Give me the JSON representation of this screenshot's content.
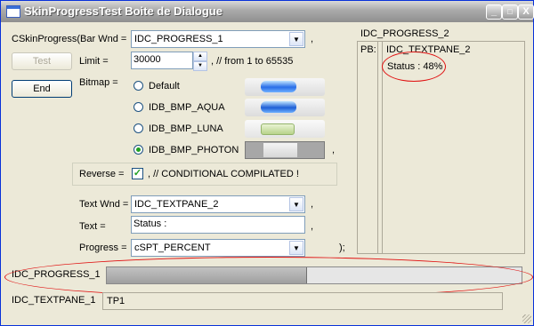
{
  "window": {
    "title": "SkinProgressTest Boite de Dialogue"
  },
  "titlebar_buttons": [
    "_",
    "□",
    "X"
  ],
  "left": {
    "bar_wnd_label": "CSkinProgress(Bar Wnd =",
    "bar_wnd_value": "IDC_PROGRESS_1",
    "bar_wnd_suffix": ",",
    "test_button": "Test",
    "end_button": "End",
    "limit_label": "Limit =",
    "limit_value": "30000",
    "limit_comment": ", // from 1 to 65535",
    "bitmap_label": "Bitmap =",
    "bitmap_options": [
      "Default",
      "IDB_BMP_AQUA",
      "IDB_BMP_LUNA",
      "IDB_BMP_PHOTON"
    ],
    "bitmap_selected": "IDB_BMP_PHOTON",
    "bitmap_suffix": ",",
    "reverse_label": "Reverse =",
    "reverse_checked": true,
    "reverse_comment": ", // CONDITIONAL COMPILATED !",
    "text_wnd_label": "Text Wnd =",
    "text_wnd_value": "IDC_TEXTPANE_2",
    "text_wnd_suffix": ",",
    "text_label": "Text =",
    "text_value": "Status :",
    "text_suffix": ",",
    "progress_label": "Progress =",
    "progress_value": "cSPT_PERCENT",
    "progress_suffix": ");"
  },
  "right": {
    "progress2_label": "IDC_PROGRESS_2",
    "pb_label": "PB:",
    "textpane2_label": "IDC_TEXTPANE_2",
    "status_text": "Status : 48%"
  },
  "bottom": {
    "progress1_label": "IDC_PROGRESS_1",
    "progress1_fraction": 0.48,
    "textpane1_label": "IDC_TEXTPANE_1",
    "textpane1_value": "TP1"
  }
}
